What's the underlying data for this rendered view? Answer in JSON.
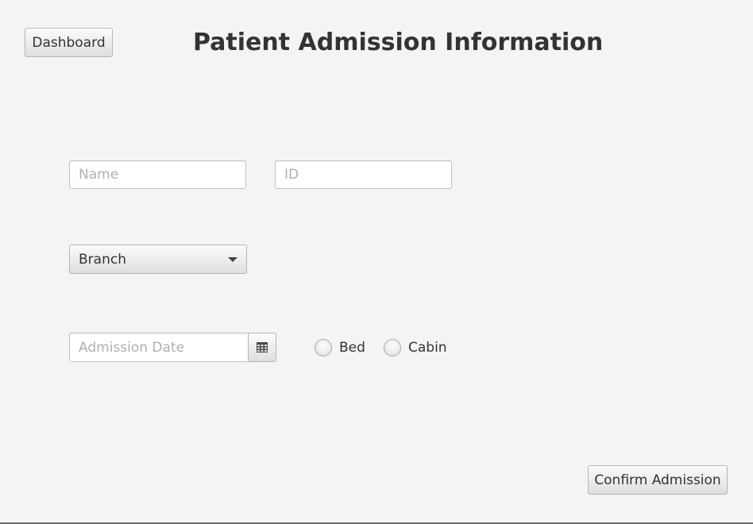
{
  "header": {
    "dashboard_label": "Dashboard",
    "title": "Patient Admission Information"
  },
  "form": {
    "name_placeholder": "Name",
    "id_placeholder": "ID",
    "branch_selected": "Branch",
    "admission_date_placeholder": "Admission Date",
    "room_type_options": [
      "Bed",
      "Cabin"
    ]
  },
  "footer": {
    "confirm_label": "Confirm Admission"
  },
  "icons": {
    "calendar": "calendar-icon",
    "dropdown": "chevron-down-icon"
  }
}
